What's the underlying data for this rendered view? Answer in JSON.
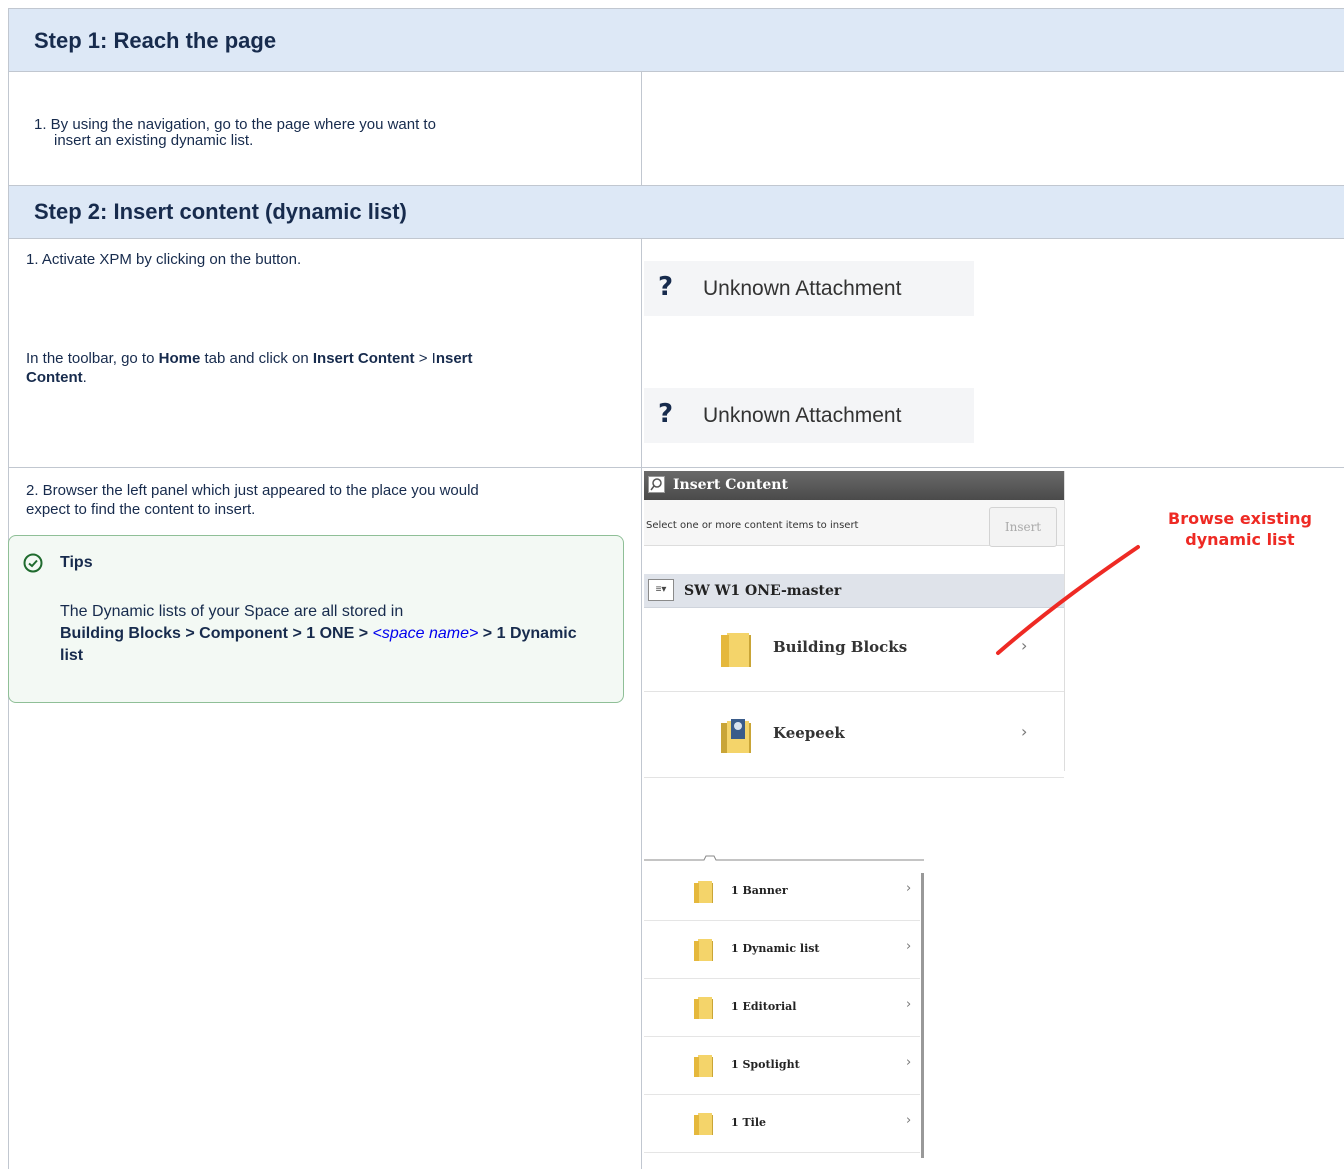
{
  "step1": {
    "title": "Step 1: Reach the page",
    "item1": "1.  By using the navigation, go to the page where you want to",
    "item1b": "insert an existing dynamic list."
  },
  "step2": {
    "title": "Step 2: Insert content (dynamic list)",
    "p1": "1. Activate XPM by clicking on the button.",
    "p2_pre": "In the toolbar, go to ",
    "p2_home": "Home",
    "p2_mid": " tab and click on ",
    "p2_ic1": "Insert Content",
    "p2_gt": " > I",
    "p2_ic2a": "nsert",
    "p2_ic2b": "Content",
    "p2_end": ".",
    "p3a": "2. Browser the left panel which just appeared to the place you would",
    "p3b": "expect to find the content to insert."
  },
  "attachments": [
    {
      "icon": "?",
      "label": "Unknown Attachment"
    },
    {
      "icon": "?",
      "label": "Unknown Attachment"
    }
  ],
  "tips": {
    "title": "Tips",
    "body_pre": "The Dynamic lists of your Space are all stored in",
    "path": "Building Blocks > Component > 1 ONE > ",
    "link": "<space name>",
    "path_end": " > 1 Dynamic list"
  },
  "insert_panel": {
    "header": "Insert Content",
    "select_text": "Select one or more content items to insert",
    "insert_button": "Insert",
    "publication": "SW W1 ONE-master",
    "items": [
      {
        "label": "Building Blocks",
        "icon": "folder-icon"
      },
      {
        "label": "Keepeek",
        "icon": "keepeek-folder-icon"
      }
    ]
  },
  "annotation": {
    "line1": "Browse existing",
    "line2": "dynamic list",
    "color": "#ee2a24"
  },
  "subfolders": [
    "1 Banner",
    "1 Dynamic list",
    "1 Editorial",
    "1 Spotlight",
    "1 Tile"
  ],
  "colors": {
    "header_bg": "#dde8f6",
    "tips_border": "#8fbf97",
    "tips_bg": "#f3f9f4",
    "link": "#0000ee"
  }
}
